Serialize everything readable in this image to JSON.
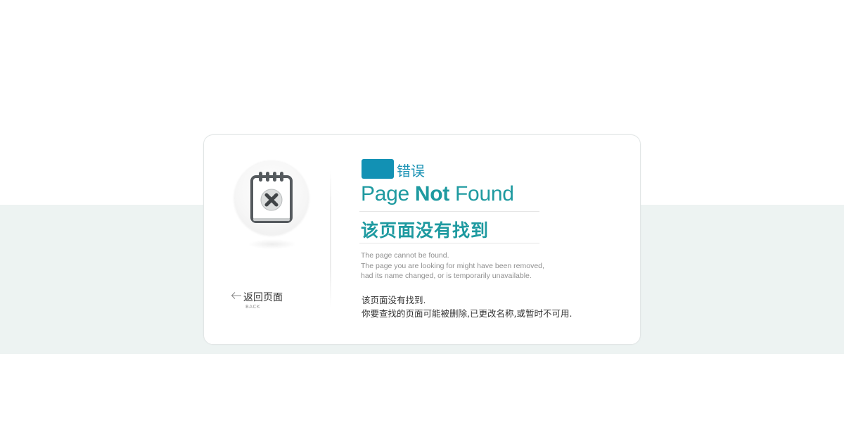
{
  "colors": {
    "accent": "#1e9aa0",
    "badge": "#1291b4",
    "band": "#edf3f2",
    "muted": "#8f8f8f"
  },
  "icon": {
    "name": "calendar-error-icon"
  },
  "back": {
    "label": "返回页面",
    "sub": "BACK",
    "arrow_icon": "left-arrow-icon"
  },
  "error": {
    "label": "错误"
  },
  "title": {
    "en_part1": "Page ",
    "en_part2": "Not",
    "en_part3": " Found",
    "cn": "该页面没有找到"
  },
  "description": {
    "en_lines": [
      "The page cannot be found.",
      "The page you are looking for might have been removed,",
      "had its name changed, or is temporarily unavailable."
    ],
    "cn_lines": [
      "该页面没有找到.",
      "你要查找的页面可能被删除,已更改名称,或暂时不可用."
    ]
  }
}
